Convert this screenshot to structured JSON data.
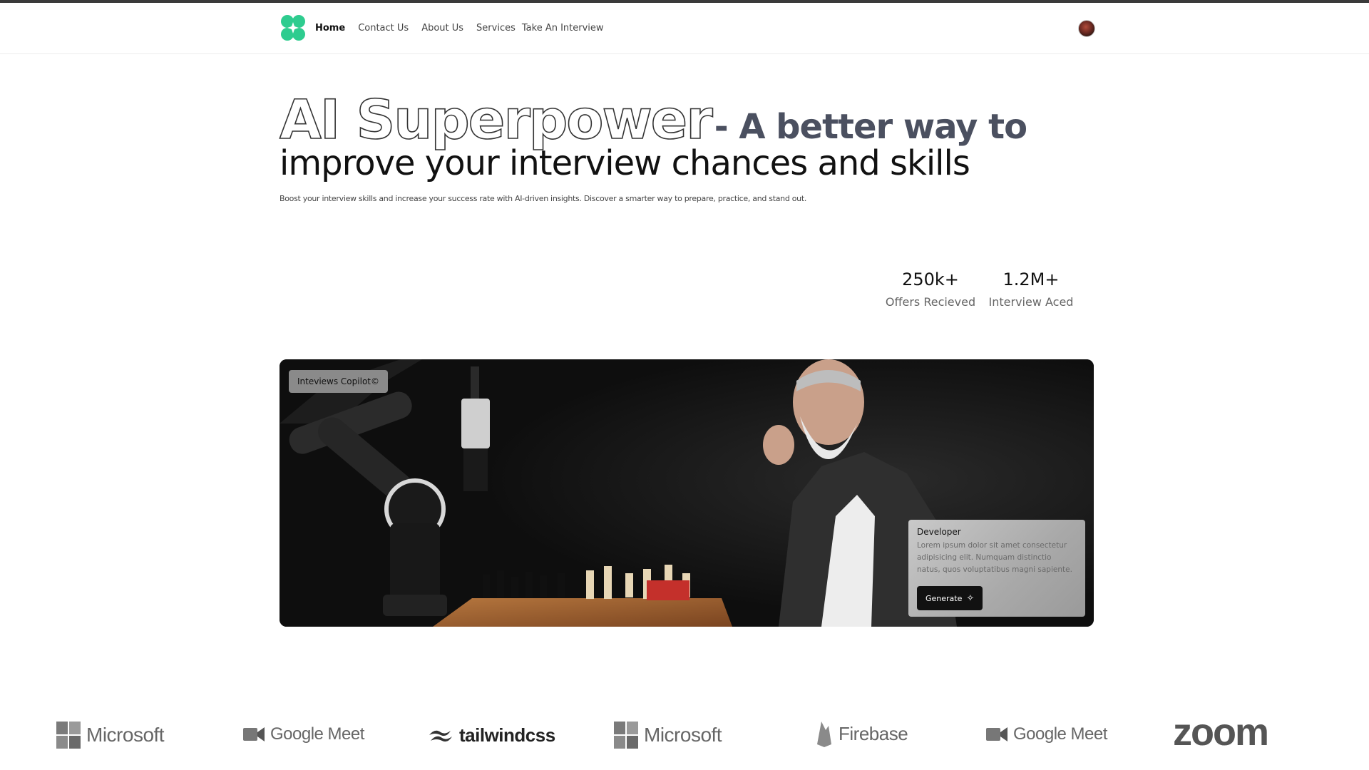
{
  "nav": {
    "items": [
      {
        "label": "Home",
        "active": true
      },
      {
        "label": "Contact Us"
      },
      {
        "label": "About Us"
      },
      {
        "label": "Services"
      },
      {
        "label": "Take An Interview"
      }
    ]
  },
  "hero": {
    "title_outline": "AI Superpower",
    "title_bold": "- A better way to",
    "title_line2": "improve your interview chances and skills",
    "subtitle": "Boost your interview skills and increase your success rate with AI-driven insights. Discover a smarter way to prepare, practice, and stand out."
  },
  "stats": [
    {
      "value": "250k+",
      "label": "Offers Recieved"
    },
    {
      "value": "1.2M+",
      "label": "Interview Aced"
    }
  ],
  "card": {
    "badge": "Inteviews Copilot©",
    "dev_title": "Developer",
    "dev_text": "Lorem ipsum dolor sit amet consectetur adipisicing elit. Numquam distinctio natus, quos voluptatibus magni sapiente.",
    "generate_label": "Generate"
  },
  "brands": [
    {
      "name": "Microsoft",
      "icon": "microsoft-icon"
    },
    {
      "name": "Google Meet",
      "icon": "google-meet-icon"
    },
    {
      "name": "tailwindcss",
      "icon": "tailwind-icon"
    },
    {
      "name": "Microsoft",
      "icon": "microsoft-icon"
    },
    {
      "name": "Firebase",
      "icon": "firebase-icon"
    },
    {
      "name": "Google Meet",
      "icon": "google-meet-icon"
    },
    {
      "name": "zoom",
      "icon": "zoom-logo"
    }
  ],
  "colors": {
    "logo_green": "#2ecc8f",
    "hero_bold": "#4b5060"
  }
}
